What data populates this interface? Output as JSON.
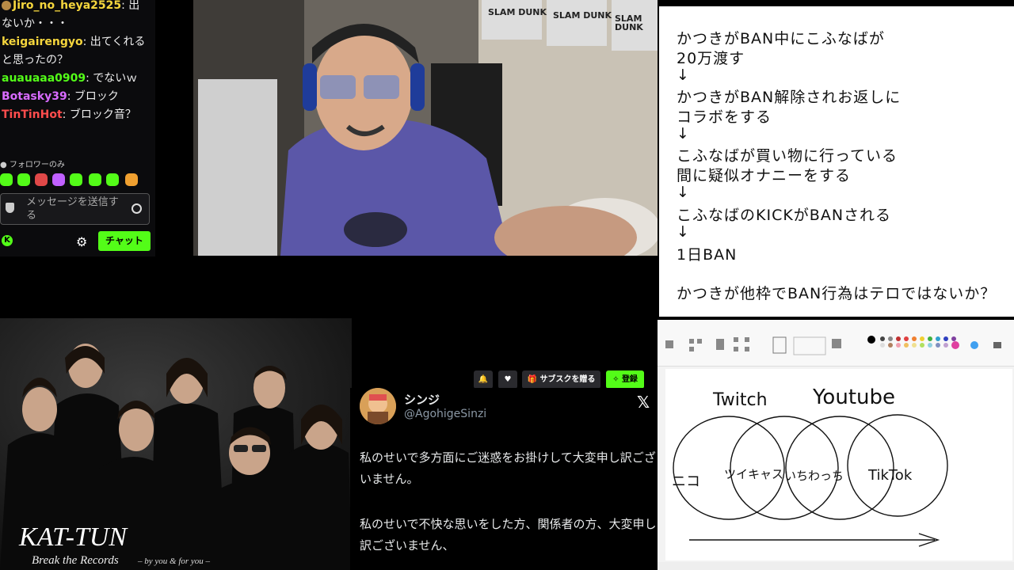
{
  "chat": {
    "messages": [
      {
        "user": "Jiro_no_heya2525",
        "color": "#f5d63d",
        "text": ": 出",
        "cont": "ないか・・・"
      },
      {
        "user": "keigairengyo",
        "color": "#f5d63d",
        "text": ": 出てくれる",
        "cont": "と思ったの？"
      },
      {
        "user": "auauaaa0909",
        "color": "#53fc18",
        "text": ": でないｗ",
        "cont": ""
      },
      {
        "user": "Botasky39",
        "color": "#d96bff",
        "text": ": ブロック",
        "cont": ""
      },
      {
        "user": "TinTinHot",
        "color": "#ff4d4d",
        "text": ": ブロック音？",
        "cont": ""
      }
    ],
    "follower_only": "フォロワーのみ",
    "placeholder": "メッセージを送信する",
    "chat_button": "チャット"
  },
  "notes": {
    "lines": [
      "かつきがBAN中にこふなばが",
      "20万渡す",
      "↓",
      "かつきがBAN解除されお返しに",
      "コラボをする",
      "↓",
      "こふなばが買い物に行っている",
      "間に疑似オナニーをする",
      "↓",
      "こふなばのKICKがBANされる",
      "↓",
      "1日BAN",
      "",
      "かつきが他枠でBAN行為はテロではないか？"
    ]
  },
  "kat": {
    "logo": "KAT-TUN",
    "subtitle": "Break the Records",
    "subtitle2": "– by you & for you –"
  },
  "kick_buttons": {
    "subscribe": "サブスクを贈る",
    "register": "登録"
  },
  "tweet": {
    "name": "シンジ",
    "handle": "@AgohigeSinzi",
    "lines": [
      "私のせいで多方面にご迷惑をお掛けして大変申し訳ござ",
      "いません。",
      "",
      "私のせいで不快な思いをした方、関係者の方、大変申し",
      "訳ございません、"
    ]
  },
  "paint": {
    "drawing_labels": [
      "Twitch",
      "Youtube",
      "ニコ",
      "ツイキャス",
      "いちわっち",
      "TikTok"
    ]
  },
  "webcam_posters": [
    "SLAM DUNK",
    "SLAM DUNK",
    "SLAM DUNK"
  ],
  "colors": {
    "kick_green": "#53fc18"
  }
}
